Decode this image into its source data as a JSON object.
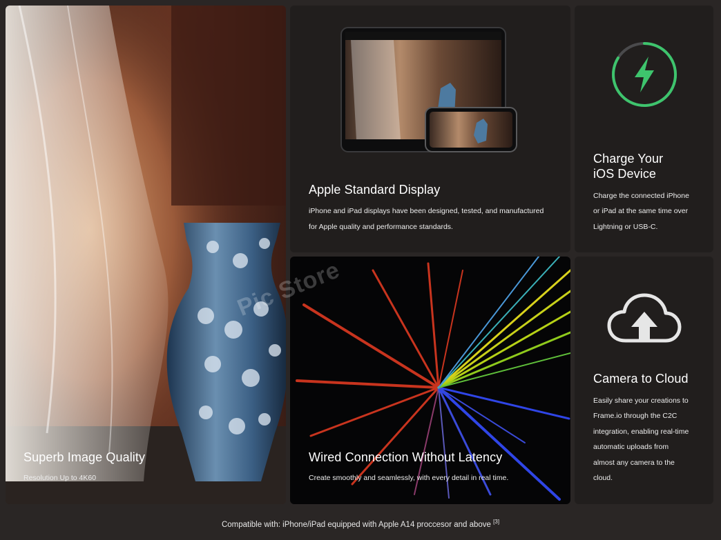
{
  "cards": {
    "image_quality": {
      "title": "Superb Image Quality",
      "desc": "Resolution Up to 4K60"
    },
    "display": {
      "title": "Apple Standard Display",
      "desc_line1": "iPhone and iPad displays have been designed, tested, and manufactured",
      "desc_line2": "for Apple quality and performance standards."
    },
    "charge": {
      "title_line1": "Charge Your",
      "title_line2": "iOS Device",
      "desc_line1": "Charge the connected iPhone",
      "desc_line2": "or iPad at the same time over",
      "desc_line3": "Lightning or USB-C."
    },
    "wired": {
      "title": "Wired Connection Without Latency",
      "desc": "Create smoothly and seamlessly, with every detail in real time."
    },
    "cloud": {
      "title": "Camera to Cloud",
      "desc_line1": "Easily share your creations to",
      "desc_line2": "Frame.io through the C2C",
      "desc_line3": "integration, enabling real-time",
      "desc_line4": "automatic uploads from",
      "desc_line5": "almost any camera to the",
      "desc_line6": "cloud."
    }
  },
  "footer": {
    "text": "Compatible with: iPhone/iPad equipped with Apple A14 proccesor and above",
    "ref": "[3]"
  },
  "watermark": "Pic Store",
  "icons": {
    "charge": "lightning-bolt-icon",
    "cloud": "cloud-upload-icon"
  },
  "colors": {
    "accent_green": "#3ec46d",
    "card_bg": "#211e1d",
    "page_bg": "#2a2625"
  }
}
